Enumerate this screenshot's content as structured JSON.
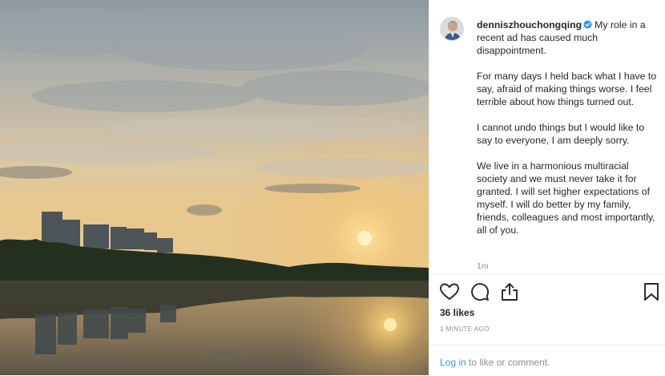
{
  "post": {
    "username": "denniszhouchongqing",
    "caption_first": "My role in a recent ad has caused much disappointment.",
    "caption_paragraphs": [
      "For many days I held back what I have to say, afraid of making things worse. I feel terrible about how things turned out.",
      "I cannot undo things but I would like to say to everyone, I am deeply sorry.",
      "We live in a harmonious multiracial society and we must never take it for granted. I will set higher expectations of myself. I will do better by my family, friends, colleagues and most importantly, all of you."
    ],
    "relative_time": "1m",
    "likes": "36 likes",
    "timestamp": "1 MINUTE AGO"
  },
  "icons": {
    "verified": "verified-badge-icon",
    "like": "heart-icon",
    "comment": "comment-bubble-icon",
    "share": "share-icon",
    "save": "bookmark-icon"
  },
  "login": {
    "link_text": "Log in",
    "rest_text": " to like or comment."
  },
  "colors": {
    "link": "#3897f0",
    "verified": "#3897f0",
    "muted": "#8e8e8e",
    "text": "#262626"
  }
}
